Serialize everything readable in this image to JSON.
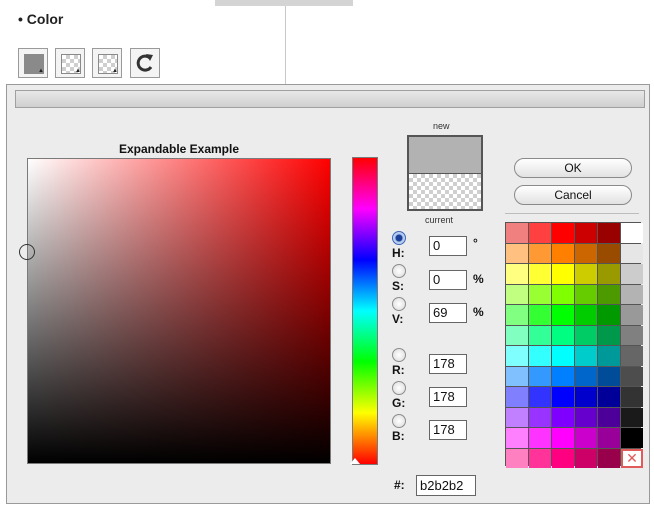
{
  "section": {
    "title": "• Color"
  },
  "toolbar": {
    "buttons": [
      {
        "name": "fill-color-button"
      },
      {
        "name": "stroke-color-button"
      },
      {
        "name": "background-color-button"
      },
      {
        "name": "reset-colors-button"
      }
    ]
  },
  "picker": {
    "title": "Expandable Example",
    "new_label": "new",
    "current_label": "current",
    "new_color": "#b2b2b2"
  },
  "fields": {
    "h": {
      "label": "H:",
      "value": "0",
      "unit": "°"
    },
    "s": {
      "label": "S:",
      "value": "0",
      "unit": "%"
    },
    "v": {
      "label": "V:",
      "value": "69",
      "unit": "%"
    },
    "r": {
      "label": "R:",
      "value": "178"
    },
    "g": {
      "label": "G:",
      "value": "178"
    },
    "b": {
      "label": "B:",
      "value": "178"
    },
    "hex": {
      "label": "#:",
      "value": "b2b2b2"
    }
  },
  "buttons": {
    "ok": "OK",
    "cancel": "Cancel"
  },
  "palette": {
    "colors": [
      "#f08080",
      "#ff4040",
      "#ff0000",
      "#cc0000",
      "#990000",
      "#ffffff",
      "#ffc080",
      "#ff9933",
      "#ff8000",
      "#cc6600",
      "#994c00",
      "#e6e6e6",
      "#ffff80",
      "#ffff33",
      "#ffff00",
      "#cccc00",
      "#999900",
      "#cccccc",
      "#c0ff80",
      "#99ff33",
      "#80ff00",
      "#66cc00",
      "#4c9900",
      "#b3b3b3",
      "#80ff80",
      "#33ff33",
      "#00ff00",
      "#00cc00",
      "#009900",
      "#999999",
      "#80ffc0",
      "#33ff99",
      "#00ff80",
      "#00cc66",
      "#00994c",
      "#808080",
      "#80ffff",
      "#33ffff",
      "#00ffff",
      "#00cccc",
      "#009999",
      "#666666",
      "#80c0ff",
      "#3399ff",
      "#0080ff",
      "#0066cc",
      "#004c99",
      "#4d4d4d",
      "#8080ff",
      "#3333ff",
      "#0000ff",
      "#0000cc",
      "#000099",
      "#333333",
      "#c080ff",
      "#9933ff",
      "#8000ff",
      "#6600cc",
      "#4c0099",
      "#1a1a1a",
      "#ff80ff",
      "#ff33ff",
      "#ff00ff",
      "#cc00cc",
      "#990099",
      "#000000",
      "#ff80c0",
      "#ff3399",
      "#ff0080",
      "#cc0066",
      "#99004c",
      "none"
    ]
  }
}
